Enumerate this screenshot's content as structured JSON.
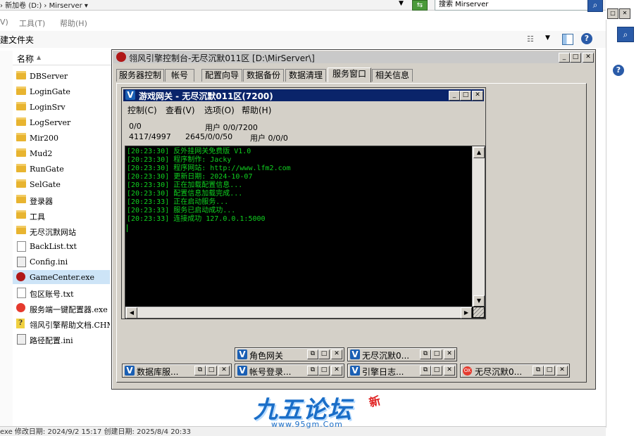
{
  "explorer": {
    "address_text": "› 新加卷 (D:) › Mirserver ▾",
    "search_placeholder": "搜索 Mirserver",
    "menu": [
      "V)",
      "工具(T)",
      "帮助(H)"
    ],
    "cmd_label": "建文件夹",
    "column_name": "名称",
    "files": [
      {
        "name": "DBServer",
        "type": "folder"
      },
      {
        "name": "LoginGate",
        "type": "folder"
      },
      {
        "name": "LoginSrv",
        "type": "folder"
      },
      {
        "name": "LogServer",
        "type": "folder"
      },
      {
        "name": "Mir200",
        "type": "folder"
      },
      {
        "name": "Mud2",
        "type": "folder"
      },
      {
        "name": "RunGate",
        "type": "folder"
      },
      {
        "name": "SelGate",
        "type": "folder"
      },
      {
        "name": "登录器",
        "type": "folder"
      },
      {
        "name": "工具",
        "type": "folder"
      },
      {
        "name": "无尽沉默网站",
        "type": "folder"
      },
      {
        "name": "BackList.txt",
        "type": "doc"
      },
      {
        "name": "Config.ini",
        "type": "ini"
      },
      {
        "name": "GameCenter.exe",
        "type": "exe",
        "selected": true
      },
      {
        "name": "包区账号.txt",
        "type": "doc"
      },
      {
        "name": "服务端一键配置器.exe",
        "type": "exe2"
      },
      {
        "name": "翎风引擎帮助文档.CHM",
        "type": "chm"
      },
      {
        "name": "路径配置.ini",
        "type": "ini"
      }
    ],
    "status_text": "exe  修改日期: 2024/9/2 15:17        创建日期: 2025/8/4 20:33"
  },
  "control_window": {
    "title": "翎风引擎控制台-无尽沉默011区  [D:\\MirServer\\]",
    "tabs": [
      "服务器控制",
      "帐号",
      "配置向导",
      "数据备份",
      "数据清理",
      "服务窗口",
      "相关信息"
    ],
    "active_tab": 5
  },
  "gateway_window": {
    "title": "游戏网关 - 无尽沉默011区(7200)",
    "menu": [
      "控制(C)",
      "查看(V)",
      "选项(O)",
      "帮助(H)"
    ],
    "stats_row1": [
      "0/0",
      "用户 0/0/7200"
    ],
    "stats_row2": [
      "4117/4997",
      "2645/0/0/50",
      "用户 0/0/0"
    ],
    "log": [
      "[20:23:30] 反外挂网关免费版 V1.0",
      "[20:23:30] 程序制作: Jacky",
      "[20:23:30] 程序网站: http://www.lfm2.com",
      "[20:23:30] 更新日期: 2024-10-07",
      "[20:23:30] 正在加载配置信息...",
      "[20:23:30] 配置信息加载完成...",
      "[20:23:33] 正在启动服务...",
      "[20:23:33] 服务已启动成功...",
      "[20:23:33] 连接成功 127.0.0.1:5000"
    ],
    "log_color": "#10d020"
  },
  "minimized_windows": [
    {
      "title": "角色网关",
      "icon": "v-icon"
    },
    {
      "title": "无尽沉默0...",
      "icon": "v-icon"
    },
    {
      "title": "数据库服...",
      "icon": "v-icon"
    },
    {
      "title": "帐号登录...",
      "icon": "v-icon"
    },
    {
      "title": "引擎日志...",
      "icon": "v-icon"
    },
    {
      "title": "无尽沉默0...",
      "icon": "ox-icon"
    }
  ],
  "watermark": {
    "text": "九五论坛",
    "badge": "新",
    "url": "www.95gm.Com"
  }
}
